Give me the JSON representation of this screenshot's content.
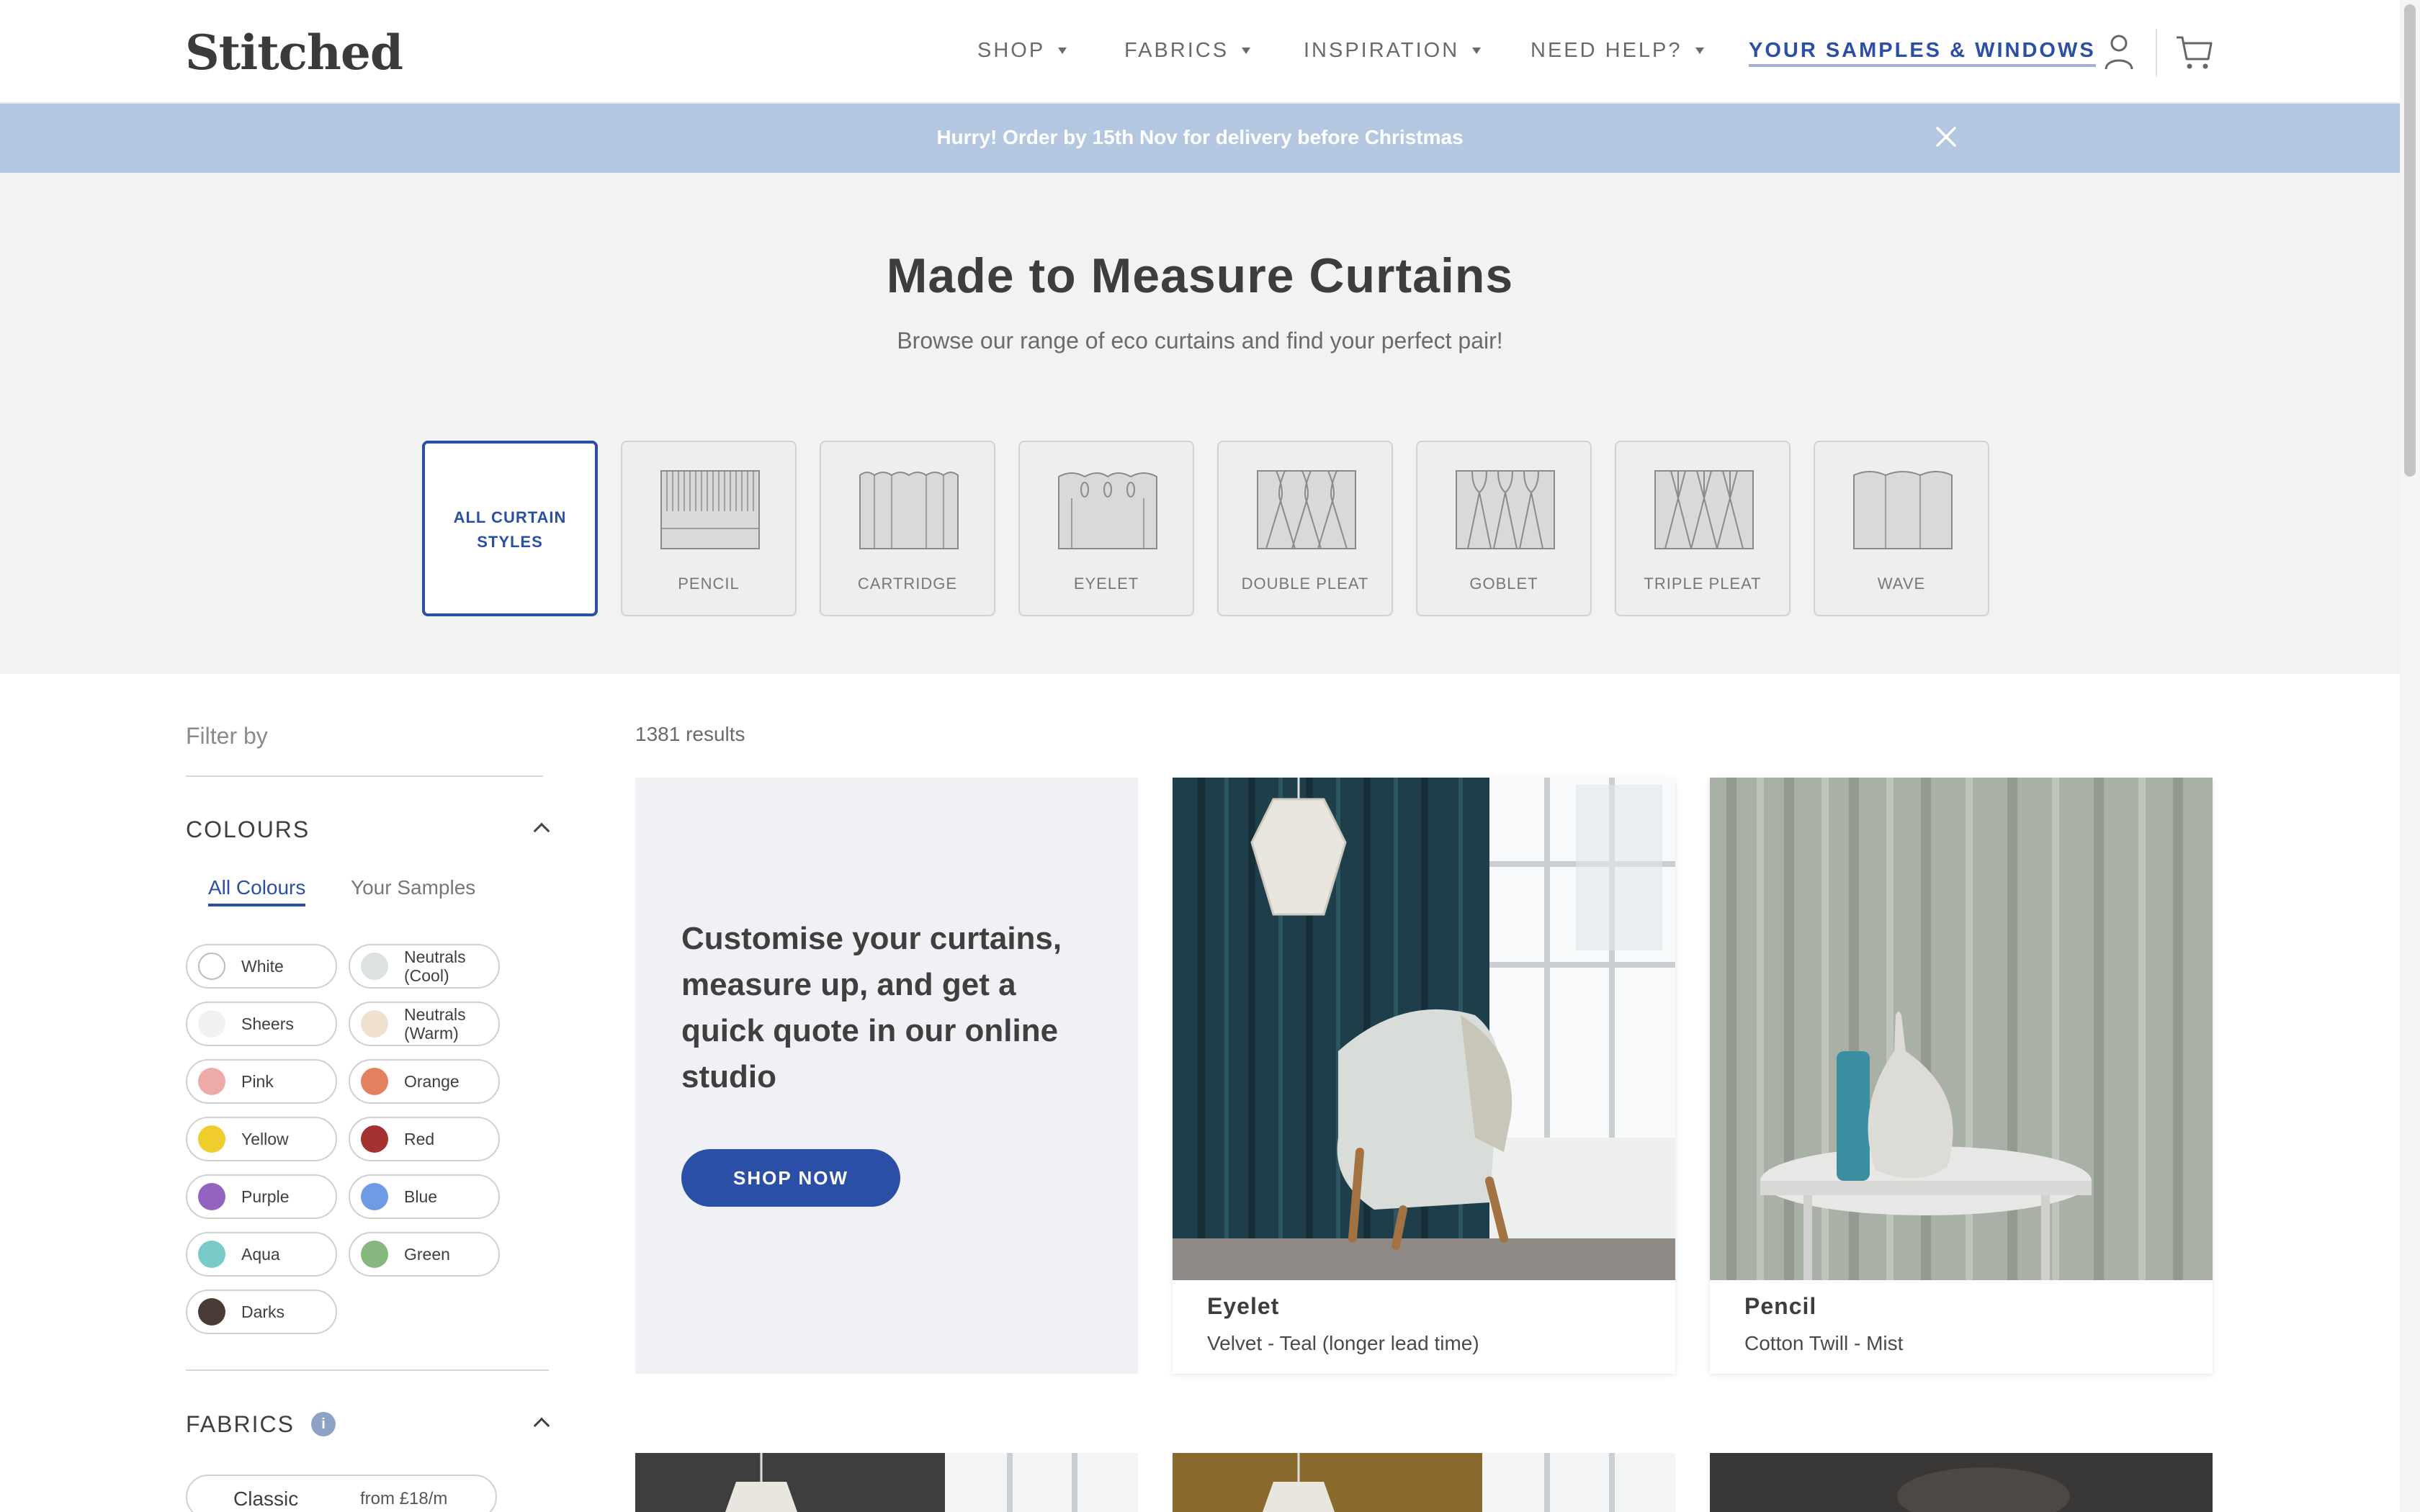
{
  "header": {
    "logo": "Stitched",
    "nav": [
      {
        "label": "SHOP"
      },
      {
        "label": "FABRICS"
      },
      {
        "label": "INSPIRATION"
      },
      {
        "label": "NEED HELP?"
      }
    ],
    "samples_link": "YOUR SAMPLES & WINDOWS",
    "icons": [
      "account-icon",
      "cart-icon"
    ]
  },
  "banner": {
    "text": "Hurry! Order by 15th Nov for delivery before Christmas",
    "close_icon": "close-icon"
  },
  "hero": {
    "title": "Made to Measure Curtains",
    "subtitle": "Browse our range of eco curtains and find your perfect pair!"
  },
  "styles": [
    {
      "label": "ALL CURTAIN STYLES",
      "active": true
    },
    {
      "label": "PENCIL"
    },
    {
      "label": "CARTRIDGE"
    },
    {
      "label": "EYELET"
    },
    {
      "label": "DOUBLE PLEAT"
    },
    {
      "label": "GOBLET"
    },
    {
      "label": "TRIPLE PLEAT"
    },
    {
      "label": "WAVE"
    }
  ],
  "sidebar": {
    "filter_by": "Filter by",
    "colours": {
      "title": "COLOURS",
      "tabs": [
        "All Colours",
        "Your Samples"
      ],
      "chips": [
        {
          "label": "White",
          "color": "#ffffff"
        },
        {
          "label": "Neutrals (Cool)",
          "color": "#dde3e0"
        },
        {
          "label": "Sheers",
          "color": "#f1f1f1"
        },
        {
          "label": "Neutrals (Warm)",
          "color": "#efe0d0"
        },
        {
          "label": "Pink",
          "color": "#eea9a9"
        },
        {
          "label": "Orange",
          "color": "#e3815e"
        },
        {
          "label": "Yellow",
          "color": "#efcd2c"
        },
        {
          "label": "Red",
          "color": "#a43232"
        },
        {
          "label": "Purple",
          "color": "#9463c1"
        },
        {
          "label": "Blue",
          "color": "#6f9be4"
        },
        {
          "label": "Aqua",
          "color": "#78cbc6"
        },
        {
          "label": "Green",
          "color": "#87b67e"
        },
        {
          "label": "Darks",
          "color": "#4a3b37"
        }
      ]
    },
    "fabrics": {
      "title": "FABRICS",
      "info": "i",
      "first": {
        "label": "Classic",
        "price": "from £18/m"
      }
    }
  },
  "results": {
    "count": "1381 results",
    "promo": {
      "text": "Customise your curtains, measure up, and get a quick quote in our online studio",
      "button": "SHOP NOW"
    },
    "products": [
      {
        "name": "Eyelet",
        "sub": "Velvet - Teal (longer lead time)"
      },
      {
        "name": "Pencil",
        "sub": "Cotton Twill - Mist"
      }
    ]
  },
  "colors": {
    "accent": "#2b4fa6",
    "banner": "#b4c7e1",
    "hero_bg": "#f2f2f2"
  }
}
